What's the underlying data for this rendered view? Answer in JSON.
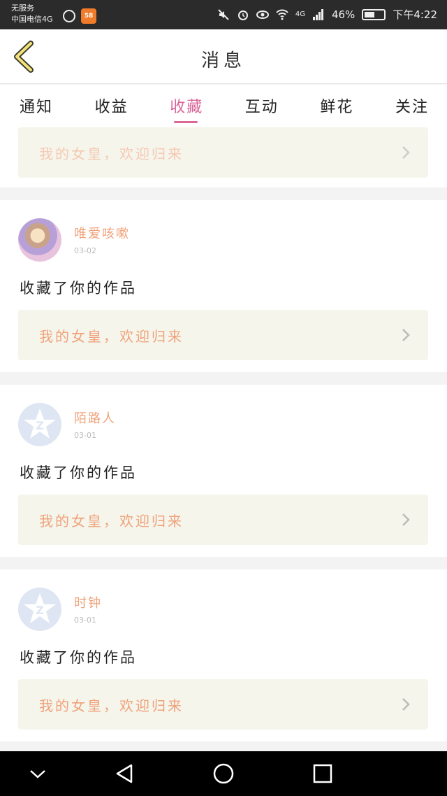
{
  "status_bar": {
    "carrier_line1": "无服务",
    "carrier_line2": "中国电信4G",
    "netease_icon": "netease-music-icon",
    "app_icon_label": "58",
    "network": "4G",
    "battery_percent": "46%",
    "battery_level": 0.46,
    "time": "下午4:22"
  },
  "header": {
    "title": "消息",
    "back_icon": "chevron-left-icon"
  },
  "tabs": [
    {
      "label": "通知"
    },
    {
      "label": "收益"
    },
    {
      "label": "收藏",
      "active": true
    },
    {
      "label": "互动"
    },
    {
      "label": "鲜花"
    },
    {
      "label": "关注"
    }
  ],
  "messages": [
    {
      "partial": true,
      "work_title": "我的女皇，欢迎归来"
    },
    {
      "user": "唯爱咳嗽",
      "date": "03-02",
      "action": "收藏了你的作品",
      "work_title": "我的女皇，欢迎归来",
      "avatar": "photo"
    },
    {
      "user": "陌路人",
      "date": "03-01",
      "action": "收藏了你的作品",
      "work_title": "我的女皇，欢迎归来",
      "avatar": "qq-default"
    },
    {
      "user": "时钟",
      "date": "03-01",
      "action": "收藏了你的作品",
      "work_title": "我的女皇，欢迎归来",
      "avatar": "qq-default"
    }
  ],
  "colors": {
    "accent": "#d9679a",
    "link_text": "#f0a27a",
    "card_bg": "#f5f5ec"
  }
}
